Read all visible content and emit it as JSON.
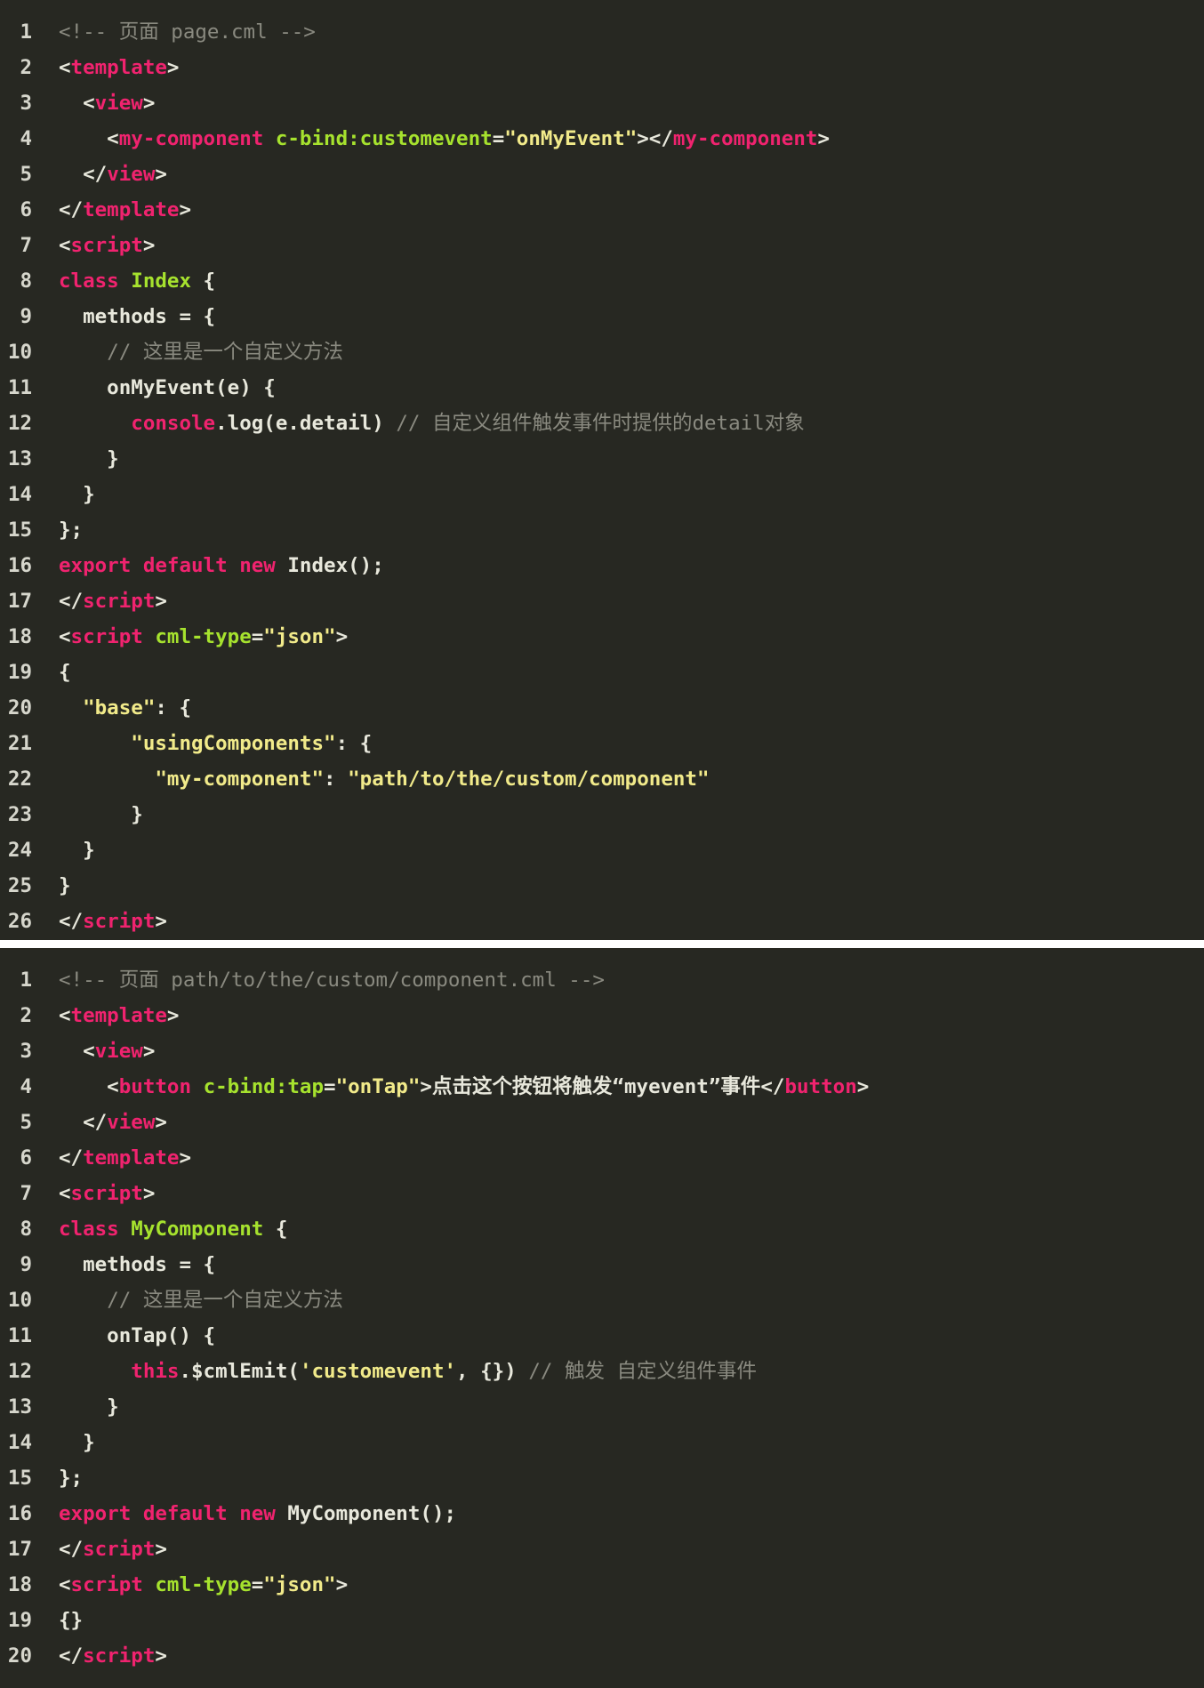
{
  "colors": {
    "background": "#272822",
    "line_number": "#d6d6cc",
    "comment": "#8a8a80",
    "tag_keyword": "#f0236f",
    "attribute_class": "#a6e22e",
    "string": "#f1ea8a",
    "plain": "#e8e8dc"
  },
  "code_blocks": [
    {
      "lines": [
        {
          "n": "1",
          "tokens": [
            {
              "t": "<!-- 页面 page.cml -->",
              "c": "comment"
            }
          ]
        },
        {
          "n": "2",
          "tokens": [
            {
              "t": "<",
              "c": "punc"
            },
            {
              "t": "template",
              "c": "tag"
            },
            {
              "t": ">",
              "c": "punc"
            }
          ]
        },
        {
          "n": "3",
          "tokens": [
            {
              "t": "  <",
              "c": "punc"
            },
            {
              "t": "view",
              "c": "tag"
            },
            {
              "t": ">",
              "c": "punc"
            }
          ]
        },
        {
          "n": "4",
          "tokens": [
            {
              "t": "    <",
              "c": "punc"
            },
            {
              "t": "my-component",
              "c": "tag"
            },
            {
              "t": " ",
              "c": "plain"
            },
            {
              "t": "c-bind:customevent",
              "c": "attr"
            },
            {
              "t": "=",
              "c": "punc"
            },
            {
              "t": "\"onMyEvent\"",
              "c": "str"
            },
            {
              "t": "></",
              "c": "punc"
            },
            {
              "t": "my-component",
              "c": "tag"
            },
            {
              "t": ">",
              "c": "punc"
            }
          ]
        },
        {
          "n": "5",
          "tokens": [
            {
              "t": "  </",
              "c": "punc"
            },
            {
              "t": "view",
              "c": "tag"
            },
            {
              "t": ">",
              "c": "punc"
            }
          ]
        },
        {
          "n": "6",
          "tokens": [
            {
              "t": "</",
              "c": "punc"
            },
            {
              "t": "template",
              "c": "tag"
            },
            {
              "t": ">",
              "c": "punc"
            }
          ]
        },
        {
          "n": "7",
          "tokens": [
            {
              "t": "<",
              "c": "punc"
            },
            {
              "t": "script",
              "c": "tag"
            },
            {
              "t": ">",
              "c": "punc"
            }
          ]
        },
        {
          "n": "8",
          "tokens": [
            {
              "t": "class",
              "c": "kw"
            },
            {
              "t": " ",
              "c": "plain"
            },
            {
              "t": "Index",
              "c": "cls"
            },
            {
              "t": " {",
              "c": "plain"
            }
          ]
        },
        {
          "n": "9",
          "tokens": [
            {
              "t": "  methods = {",
              "c": "plain"
            }
          ]
        },
        {
          "n": "10",
          "tokens": [
            {
              "t": "    ",
              "c": "plain"
            },
            {
              "t": "// 这里是一个自定义方法",
              "c": "comment"
            }
          ]
        },
        {
          "n": "11",
          "tokens": [
            {
              "t": "    onMyEvent(e) {",
              "c": "plain"
            }
          ]
        },
        {
          "n": "12",
          "tokens": [
            {
              "t": "      ",
              "c": "plain"
            },
            {
              "t": "console",
              "c": "kw"
            },
            {
              "t": ".log(e.detail) ",
              "c": "plain"
            },
            {
              "t": "// 自定义组件触发事件时提供的detail对象",
              "c": "comment"
            }
          ]
        },
        {
          "n": "13",
          "tokens": [
            {
              "t": "    }",
              "c": "plain"
            }
          ]
        },
        {
          "n": "14",
          "tokens": [
            {
              "t": "  }",
              "c": "plain"
            }
          ]
        },
        {
          "n": "15",
          "tokens": [
            {
              "t": "};",
              "c": "plain"
            }
          ]
        },
        {
          "n": "16",
          "tokens": [
            {
              "t": "export",
              "c": "kw"
            },
            {
              "t": " ",
              "c": "plain"
            },
            {
              "t": "default",
              "c": "kw"
            },
            {
              "t": " ",
              "c": "plain"
            },
            {
              "t": "new",
              "c": "kw"
            },
            {
              "t": " Index();",
              "c": "plain"
            }
          ]
        },
        {
          "n": "17",
          "tokens": [
            {
              "t": "</",
              "c": "punc"
            },
            {
              "t": "script",
              "c": "tag"
            },
            {
              "t": ">",
              "c": "punc"
            }
          ]
        },
        {
          "n": "18",
          "tokens": [
            {
              "t": "<",
              "c": "punc"
            },
            {
              "t": "script",
              "c": "tag"
            },
            {
              "t": " ",
              "c": "plain"
            },
            {
              "t": "cml-type",
              "c": "attr"
            },
            {
              "t": "=",
              "c": "punc"
            },
            {
              "t": "\"json\"",
              "c": "str"
            },
            {
              "t": ">",
              "c": "punc"
            }
          ]
        },
        {
          "n": "19",
          "tokens": [
            {
              "t": "{",
              "c": "plain"
            }
          ]
        },
        {
          "n": "20",
          "tokens": [
            {
              "t": "  ",
              "c": "plain"
            },
            {
              "t": "\"base\"",
              "c": "str"
            },
            {
              "t": ": {",
              "c": "plain"
            }
          ]
        },
        {
          "n": "21",
          "tokens": [
            {
              "t": "      ",
              "c": "plain"
            },
            {
              "t": "\"usingComponents\"",
              "c": "str"
            },
            {
              "t": ": {",
              "c": "plain"
            }
          ]
        },
        {
          "n": "22",
          "tokens": [
            {
              "t": "        ",
              "c": "plain"
            },
            {
              "t": "\"my-component\"",
              "c": "str"
            },
            {
              "t": ": ",
              "c": "plain"
            },
            {
              "t": "\"path/to/the/custom/component\"",
              "c": "str"
            }
          ]
        },
        {
          "n": "23",
          "tokens": [
            {
              "t": "      }",
              "c": "plain"
            }
          ]
        },
        {
          "n": "24",
          "tokens": [
            {
              "t": "  }",
              "c": "plain"
            }
          ]
        },
        {
          "n": "25",
          "tokens": [
            {
              "t": "}",
              "c": "plain"
            }
          ]
        },
        {
          "n": "26",
          "tokens": [
            {
              "t": "</",
              "c": "punc"
            },
            {
              "t": "script",
              "c": "tag"
            },
            {
              "t": ">",
              "c": "punc"
            }
          ]
        }
      ]
    },
    {
      "lines": [
        {
          "n": "1",
          "tokens": [
            {
              "t": "<!-- 页面 path/to/the/custom/component.cml -->",
              "c": "comment"
            }
          ]
        },
        {
          "n": "2",
          "tokens": [
            {
              "t": "<",
              "c": "punc"
            },
            {
              "t": "template",
              "c": "tag"
            },
            {
              "t": ">",
              "c": "punc"
            }
          ]
        },
        {
          "n": "3",
          "tokens": [
            {
              "t": "  <",
              "c": "punc"
            },
            {
              "t": "view",
              "c": "tag"
            },
            {
              "t": ">",
              "c": "punc"
            }
          ]
        },
        {
          "n": "4",
          "tokens": [
            {
              "t": "    <",
              "c": "punc"
            },
            {
              "t": "button",
              "c": "tag"
            },
            {
              "t": " ",
              "c": "plain"
            },
            {
              "t": "c-bind:tap",
              "c": "attr"
            },
            {
              "t": "=",
              "c": "punc"
            },
            {
              "t": "\"onTap\"",
              "c": "str"
            },
            {
              "t": ">点击这个按钮将触发“myevent”事件</",
              "c": "plain"
            },
            {
              "t": "button",
              "c": "tag"
            },
            {
              "t": ">",
              "c": "punc"
            }
          ]
        },
        {
          "n": "5",
          "tokens": [
            {
              "t": "  </",
              "c": "punc"
            },
            {
              "t": "view",
              "c": "tag"
            },
            {
              "t": ">",
              "c": "punc"
            }
          ]
        },
        {
          "n": "6",
          "tokens": [
            {
              "t": "</",
              "c": "punc"
            },
            {
              "t": "template",
              "c": "tag"
            },
            {
              "t": ">",
              "c": "punc"
            }
          ]
        },
        {
          "n": "7",
          "tokens": [
            {
              "t": "<",
              "c": "punc"
            },
            {
              "t": "script",
              "c": "tag"
            },
            {
              "t": ">",
              "c": "punc"
            }
          ]
        },
        {
          "n": "8",
          "tokens": [
            {
              "t": "class",
              "c": "kw"
            },
            {
              "t": " ",
              "c": "plain"
            },
            {
              "t": "MyComponent",
              "c": "cls"
            },
            {
              "t": " {",
              "c": "plain"
            }
          ]
        },
        {
          "n": "9",
          "tokens": [
            {
              "t": "  methods = {",
              "c": "plain"
            }
          ]
        },
        {
          "n": "10",
          "tokens": [
            {
              "t": "    ",
              "c": "plain"
            },
            {
              "t": "// 这里是一个自定义方法",
              "c": "comment"
            }
          ]
        },
        {
          "n": "11",
          "tokens": [
            {
              "t": "    onTap() {",
              "c": "plain"
            }
          ]
        },
        {
          "n": "12",
          "tokens": [
            {
              "t": "      ",
              "c": "plain"
            },
            {
              "t": "this",
              "c": "kw"
            },
            {
              "t": ".$cmlEmit(",
              "c": "plain"
            },
            {
              "t": "'customevent'",
              "c": "str"
            },
            {
              "t": ", {}) ",
              "c": "plain"
            },
            {
              "t": "// 触发 自定义组件事件",
              "c": "comment"
            }
          ]
        },
        {
          "n": "13",
          "tokens": [
            {
              "t": "    }",
              "c": "plain"
            }
          ]
        },
        {
          "n": "14",
          "tokens": [
            {
              "t": "  }",
              "c": "plain"
            }
          ]
        },
        {
          "n": "15",
          "tokens": [
            {
              "t": "};",
              "c": "plain"
            }
          ]
        },
        {
          "n": "16",
          "tokens": [
            {
              "t": "export",
              "c": "kw"
            },
            {
              "t": " ",
              "c": "plain"
            },
            {
              "t": "default",
              "c": "kw"
            },
            {
              "t": " ",
              "c": "plain"
            },
            {
              "t": "new",
              "c": "kw"
            },
            {
              "t": " MyComponent();",
              "c": "plain"
            }
          ]
        },
        {
          "n": "17",
          "tokens": [
            {
              "t": "</",
              "c": "punc"
            },
            {
              "t": "script",
              "c": "tag"
            },
            {
              "t": ">",
              "c": "punc"
            }
          ]
        },
        {
          "n": "18",
          "tokens": [
            {
              "t": "<",
              "c": "punc"
            },
            {
              "t": "script",
              "c": "tag"
            },
            {
              "t": " ",
              "c": "plain"
            },
            {
              "t": "cml-type",
              "c": "attr"
            },
            {
              "t": "=",
              "c": "punc"
            },
            {
              "t": "\"json\"",
              "c": "str"
            },
            {
              "t": ">",
              "c": "punc"
            }
          ]
        },
        {
          "n": "19",
          "tokens": [
            {
              "t": "{}",
              "c": "plain"
            }
          ]
        },
        {
          "n": "20",
          "tokens": [
            {
              "t": "</",
              "c": "punc"
            },
            {
              "t": "script",
              "c": "tag"
            },
            {
              "t": ">",
              "c": "punc"
            }
          ]
        }
      ]
    }
  ]
}
